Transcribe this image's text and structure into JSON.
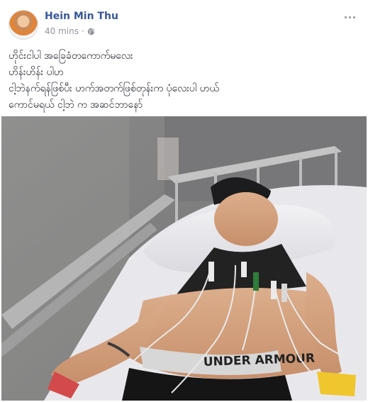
{
  "post": {
    "author": "Hein Min Thu",
    "timestamp": "40 mins",
    "privacy_icon": "globe-icon",
    "more_icon": "more-options-icon",
    "text_lines": [
      "ဟိုင်းငါပါ အခြေခံတကောက်မလေး",
      "ဟိန်းဟိန်း ပါဟ",
      "ငါ့ဘဲနက်ရန်ဖြစ်ပီး ဟက်အတက်ဖြစ်တုန်းက ပုံလေးပါ ဟယ်",
      "ကောင်မရယ် ငါ့ဘဲ က အဆင်ဘာနော်"
    ],
    "photo_waistband_text": "UNDER ARMOUR"
  }
}
